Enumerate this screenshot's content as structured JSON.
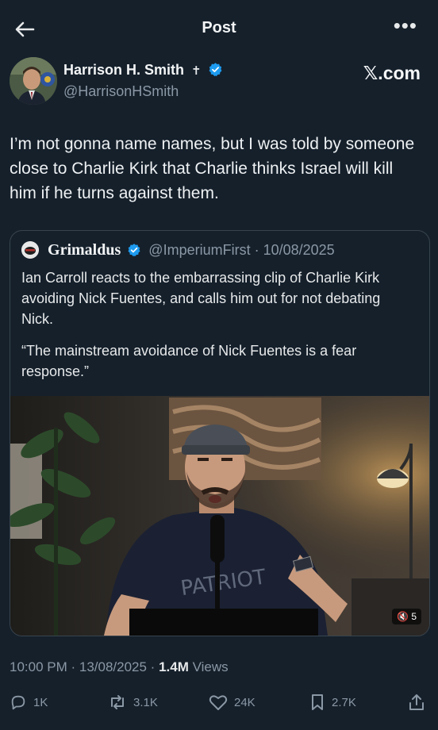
{
  "header": {
    "title": "Post",
    "more": "•••"
  },
  "author": {
    "name": "Harrison H. Smith",
    "cross": "✝",
    "handle": "@HarrisonHSmith",
    "avatar_icon": "avatar-photo-icon"
  },
  "watermark": "𝕏.com",
  "post": {
    "text": "I’m not gonna name names, but I was told by someone close to Charlie Kirk that Charlie thinks Israel will kill him if he turns against them."
  },
  "quote": {
    "name": "Grimaldus",
    "handle_date": "@ImperiumFirst · 10/08/2025",
    "text1": "Ian Carroll reacts to the embarrassing clip of Charlie Kirk avoiding Nick Fuentes, and calls him out for not debating Nick.",
    "text2": "“The mainstream avoidance of Nick Fuentes is a fear response.”",
    "video_badge": "🔇 5",
    "shirt_text": "PATRIOT"
  },
  "meta": {
    "time": "10:00 PM · 13/08/2025 · ",
    "views": "1.4M",
    "views_label": " Views"
  },
  "actions": {
    "replies": "1K",
    "reposts": "3.1K",
    "likes": "24K",
    "bookmarks": "2.7K"
  },
  "colors": {
    "background": "#15202b",
    "verified": "#1d9bf0",
    "muted": "#8b98a5",
    "border": "#38444d"
  }
}
